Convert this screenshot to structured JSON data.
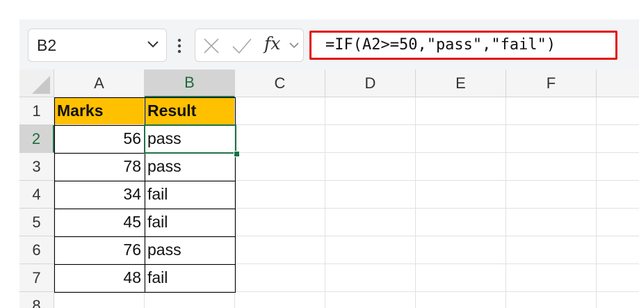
{
  "name_box": {
    "value": "B2"
  },
  "formula_bar": {
    "formula": "=IF(A2>=50,\"pass\",\"fail\")"
  },
  "columns": [
    "A",
    "B",
    "C",
    "D",
    "E",
    "F"
  ],
  "rows": [
    "1",
    "2",
    "3",
    "4",
    "5",
    "6",
    "7",
    "8"
  ],
  "table": {
    "headers": [
      "Marks",
      "Result"
    ],
    "data": [
      [
        "56",
        "pass"
      ],
      [
        "78",
        "pass"
      ],
      [
        "34",
        "fail"
      ],
      [
        "45",
        "fail"
      ],
      [
        "76",
        "pass"
      ],
      [
        "48",
        "fail"
      ]
    ]
  },
  "selection": {
    "cell": "B2"
  },
  "colors": {
    "header_fill": "#ffc000",
    "formula_highlight": "#e31010",
    "selection": "#1e7145"
  },
  "icons": {
    "name_box_dropdown": "chevron-down-icon",
    "more": "vertical-dots-icon",
    "cancel": "cross-icon",
    "enter": "check-icon",
    "function": "fx-icon"
  }
}
